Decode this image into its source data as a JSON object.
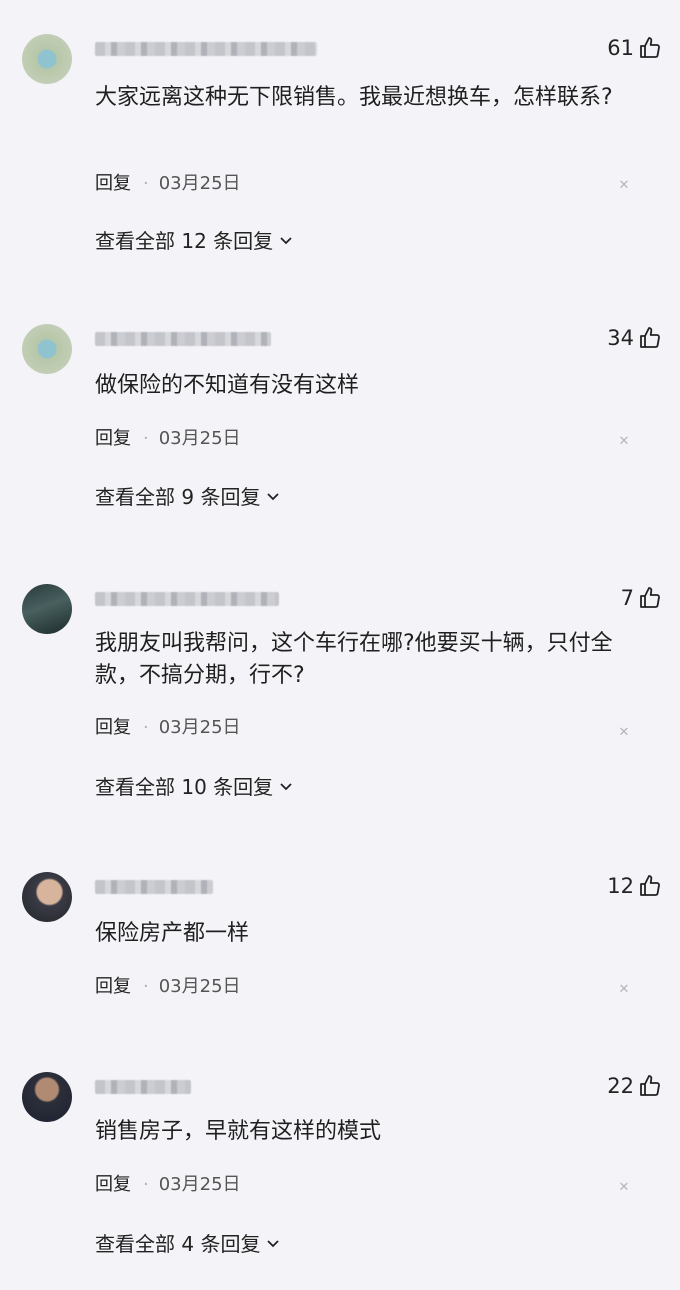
{
  "comments": [
    {
      "likes": "61",
      "text": "大家远离这种无下限销售。我最近想换车，怎样联系?",
      "reply": "回复",
      "date": "03月25日",
      "view_all": "查看全部 12 条回复"
    },
    {
      "likes": "34",
      "text": "做保险的不知道有没有这样",
      "reply": "回复",
      "date": "03月25日",
      "view_all": "查看全部 9 条回复"
    },
    {
      "likes": "7",
      "text": "我朋友叫我帮问，这个车行在哪?他要买十辆，只付全款，不搞分期，行不?",
      "reply": "回复",
      "date": "03月25日",
      "view_all": "查看全部 10 条回复"
    },
    {
      "likes": "12",
      "text": "保险房产都一样",
      "reply": "回复",
      "date": "03月25日"
    },
    {
      "likes": "22",
      "text": "销售房子，早就有这样的模式",
      "reply": "回复",
      "date": "03月25日",
      "view_all": "查看全部 4 条回复"
    }
  ],
  "separator": "·",
  "icons": {
    "like": "thumbs-up-icon",
    "close": "close-icon",
    "chevron": "chevron-down-icon"
  }
}
